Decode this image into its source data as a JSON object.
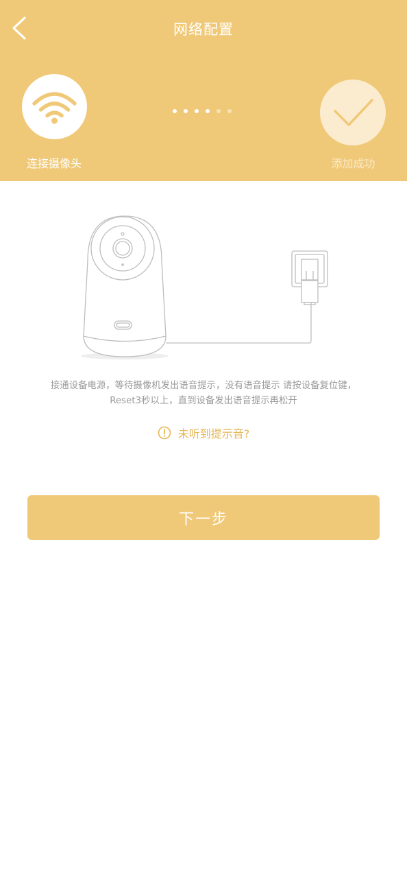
{
  "header": {
    "title": "网络配置",
    "background_color": "#f0c978",
    "back_icon": "chevron-left-icon"
  },
  "steps": {
    "left": {
      "icon": "wifi-icon",
      "label": "连接摄像头"
    },
    "right": {
      "icon": "checkmark-icon",
      "label": "添加成功"
    },
    "progress_dots": 6,
    "active_dots": 4
  },
  "illustration": {
    "items": [
      "camera-illustration",
      "power-adapter-illustration",
      "cable-illustration"
    ]
  },
  "instruction": {
    "text": "接通设备电源，等待摄像机发出语音提示，没有语音提示 请按设备复位键，Reset3秒以上，直到设备发出语音提示再松开"
  },
  "hint": {
    "icon": "alert-circle-icon",
    "text": "未听到提示音?",
    "color": "#e5b656"
  },
  "next_button": {
    "label": "下一步",
    "color": "#f0c978"
  }
}
